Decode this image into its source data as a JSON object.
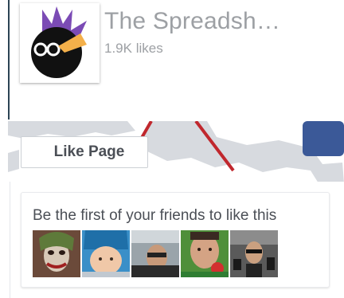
{
  "page": {
    "name": "The Spreadsh…",
    "likes": "1.9K likes"
  },
  "like_button": {
    "label": "Like Page"
  },
  "friends": {
    "title": "Be the first of your friends to like this",
    "faces": [
      "friend-1",
      "friend-2",
      "friend-3",
      "friend-4",
      "friend-5"
    ]
  },
  "colors": {
    "name_text": "#9da0a4",
    "button_text": "#4b4f56",
    "logo_purple": "#7b4bb5",
    "logo_orange": "#f4b04a",
    "map_grey": "#d7dadf",
    "map_red_line": "#c0272d",
    "cover_blue": "#3b5998"
  }
}
